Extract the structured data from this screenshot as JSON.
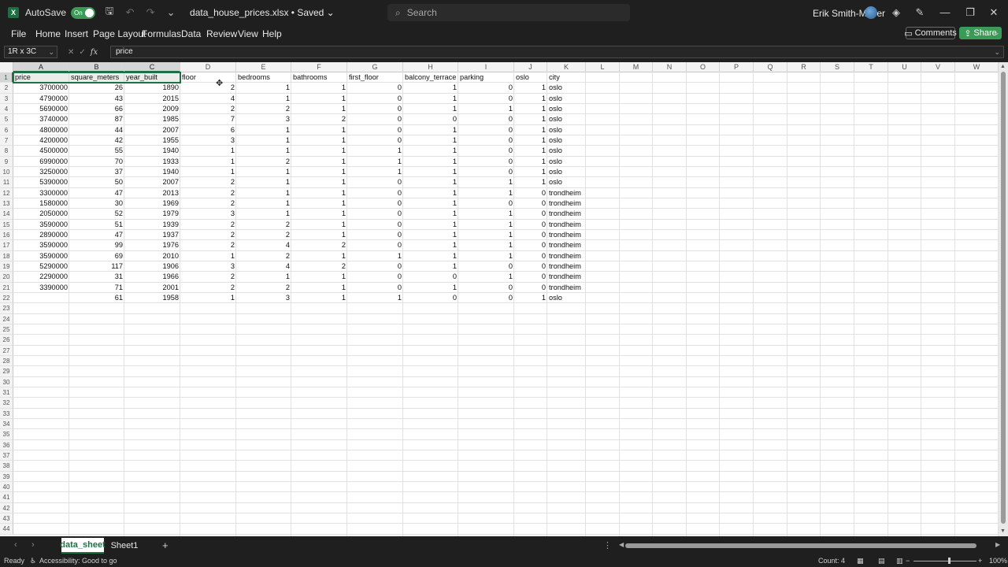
{
  "titlebar": {
    "autosave_label": "AutoSave",
    "autosave_state": "On",
    "doc_title": "data_house_prices.xlsx • Saved ⌄",
    "search_placeholder": "Search",
    "user_name": "Erik Smith-Meyer"
  },
  "menu": [
    "File",
    "Home",
    "Insert",
    "Page Layout",
    "Formulas",
    "Data",
    "Review",
    "View",
    "Help"
  ],
  "buttons": {
    "comments": "Comments",
    "share": "Share"
  },
  "formula": {
    "namebox": "1R x 3C",
    "fx": "fx",
    "value": "price"
  },
  "columns": [
    "A",
    "B",
    "C",
    "D",
    "E",
    "F",
    "G",
    "H",
    "I",
    "J",
    "K",
    "L",
    "M",
    "N",
    "O",
    "P",
    "Q",
    "R",
    "S",
    "T",
    "U",
    "V",
    "W"
  ],
  "row_numbers": [
    "1",
    "2",
    "3",
    "4",
    "5",
    "6",
    "7",
    "8",
    "9",
    "10",
    "11",
    "12",
    "13",
    "14",
    "15",
    "16",
    "17",
    "18",
    "19",
    "20",
    "21",
    "22",
    "23",
    "24",
    "25",
    "26",
    "27",
    "28",
    "29",
    "30",
    "31",
    "32",
    "33",
    "34",
    "35",
    "36",
    "37",
    "38",
    "39",
    "40",
    "41",
    "42",
    "43",
    "44"
  ],
  "headers": [
    "price",
    "square_meters",
    "year_built",
    "floor",
    "bedrooms",
    "bathrooms",
    "first_floor",
    "balcony_terrace",
    "parking",
    "oslo",
    "city"
  ],
  "rows": [
    [
      "3700000",
      "26",
      "1890",
      "2",
      "1",
      "1",
      "0",
      "1",
      "0",
      "1",
      "oslo"
    ],
    [
      "4790000",
      "43",
      "2015",
      "4",
      "1",
      "1",
      "0",
      "1",
      "0",
      "1",
      "oslo"
    ],
    [
      "5690000",
      "66",
      "2009",
      "2",
      "2",
      "1",
      "0",
      "1",
      "1",
      "1",
      "oslo"
    ],
    [
      "3740000",
      "87",
      "1985",
      "7",
      "3",
      "2",
      "0",
      "0",
      "0",
      "1",
      "oslo"
    ],
    [
      "4800000",
      "44",
      "2007",
      "6",
      "1",
      "1",
      "0",
      "1",
      "0",
      "1",
      "oslo"
    ],
    [
      "4200000",
      "42",
      "1955",
      "3",
      "1",
      "1",
      "0",
      "1",
      "0",
      "1",
      "oslo"
    ],
    [
      "4500000",
      "55",
      "1940",
      "1",
      "1",
      "1",
      "1",
      "1",
      "0",
      "1",
      "oslo"
    ],
    [
      "6990000",
      "70",
      "1933",
      "1",
      "2",
      "1",
      "1",
      "1",
      "0",
      "1",
      "oslo"
    ],
    [
      "3250000",
      "37",
      "1940",
      "1",
      "1",
      "1",
      "1",
      "1",
      "0",
      "1",
      "oslo"
    ],
    [
      "5390000",
      "50",
      "2007",
      "2",
      "1",
      "1",
      "0",
      "1",
      "1",
      "1",
      "oslo"
    ],
    [
      "3300000",
      "47",
      "2013",
      "2",
      "1",
      "1",
      "0",
      "1",
      "1",
      "0",
      "trondheim"
    ],
    [
      "1580000",
      "30",
      "1969",
      "2",
      "1",
      "1",
      "0",
      "1",
      "0",
      "0",
      "trondheim"
    ],
    [
      "2050000",
      "52",
      "1979",
      "3",
      "1",
      "1",
      "0",
      "1",
      "1",
      "0",
      "trondheim"
    ],
    [
      "3590000",
      "51",
      "1939",
      "2",
      "2",
      "1",
      "0",
      "1",
      "1",
      "0",
      "trondheim"
    ],
    [
      "2890000",
      "47",
      "1937",
      "2",
      "2",
      "1",
      "0",
      "1",
      "1",
      "0",
      "trondheim"
    ],
    [
      "3590000",
      "99",
      "1976",
      "2",
      "4",
      "2",
      "0",
      "1",
      "1",
      "0",
      "trondheim"
    ],
    [
      "3590000",
      "69",
      "2010",
      "1",
      "2",
      "1",
      "1",
      "1",
      "1",
      "0",
      "trondheim"
    ],
    [
      "5290000",
      "117",
      "1906",
      "3",
      "4",
      "2",
      "0",
      "1",
      "0",
      "0",
      "trondheim"
    ],
    [
      "2290000",
      "31",
      "1966",
      "2",
      "1",
      "1",
      "0",
      "0",
      "1",
      "0",
      "trondheim"
    ],
    [
      "3390000",
      "71",
      "2001",
      "2",
      "2",
      "1",
      "0",
      "1",
      "0",
      "0",
      "trondheim"
    ],
    [
      "",
      "61",
      "1958",
      "1",
      "3",
      "1",
      "1",
      "0",
      "0",
      "1",
      "oslo"
    ]
  ],
  "sheets": {
    "active": "data_sheet",
    "other": "Sheet1"
  },
  "status": {
    "ready": "Ready",
    "accessibility": "Accessibility: Good to go",
    "count": "Count: 4",
    "zoom": "100%"
  },
  "colors": {
    "accent": "#1e7145",
    "toggle_on": "#3a9a56"
  }
}
